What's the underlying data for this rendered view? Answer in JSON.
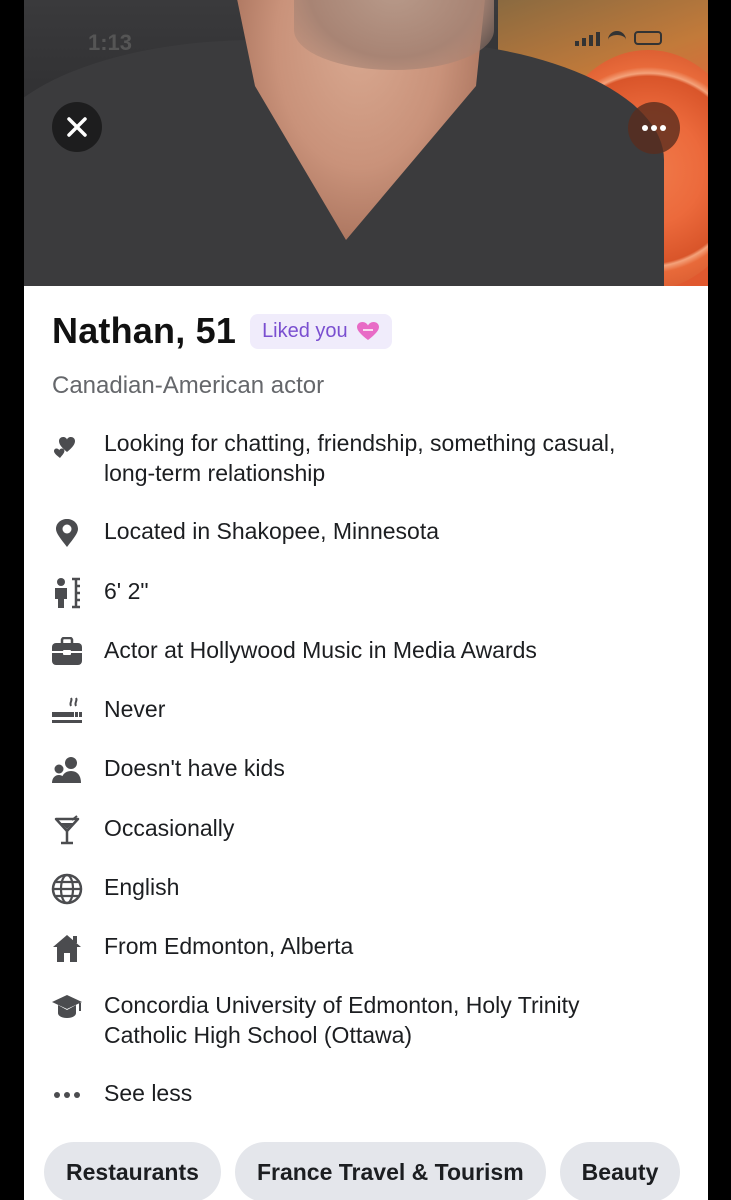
{
  "status_bar": {
    "time": "1:13"
  },
  "profile": {
    "name_age": "Nathan, 51",
    "liked_badge": "Liked you",
    "subtitle": "Canadian-American actor"
  },
  "details": [
    {
      "icon": "hearts-icon",
      "text": "Looking for chatting, friendship, something casual, long-term relationship"
    },
    {
      "icon": "location-pin-icon",
      "text": "Located in Shakopee, Minnesota"
    },
    {
      "icon": "height-icon",
      "text": "6' 2\""
    },
    {
      "icon": "briefcase-icon",
      "text": "Actor at Hollywood Music in Media Awards"
    },
    {
      "icon": "smoking-icon",
      "text": "Never"
    },
    {
      "icon": "people-icon",
      "text": "Doesn't have kids"
    },
    {
      "icon": "cocktail-icon",
      "text": "Occasionally"
    },
    {
      "icon": "globe-icon",
      "text": "English"
    },
    {
      "icon": "home-icon",
      "text": "From Edmonton, Alberta"
    },
    {
      "icon": "graduation-cap-icon",
      "text": "Concordia University of Edmonton, Holy Trinity Catholic High School (Ottawa)"
    },
    {
      "icon": "ellipsis-icon",
      "text": "See less"
    }
  ],
  "interests": [
    "Restaurants",
    "France Travel & Tourism",
    "Beauty"
  ],
  "colors": {
    "accent_purple": "#7a4fd0",
    "badge_bg": "#f0ecfb",
    "secondary_text": "#65676b",
    "chip_bg": "#e4e6eb"
  }
}
